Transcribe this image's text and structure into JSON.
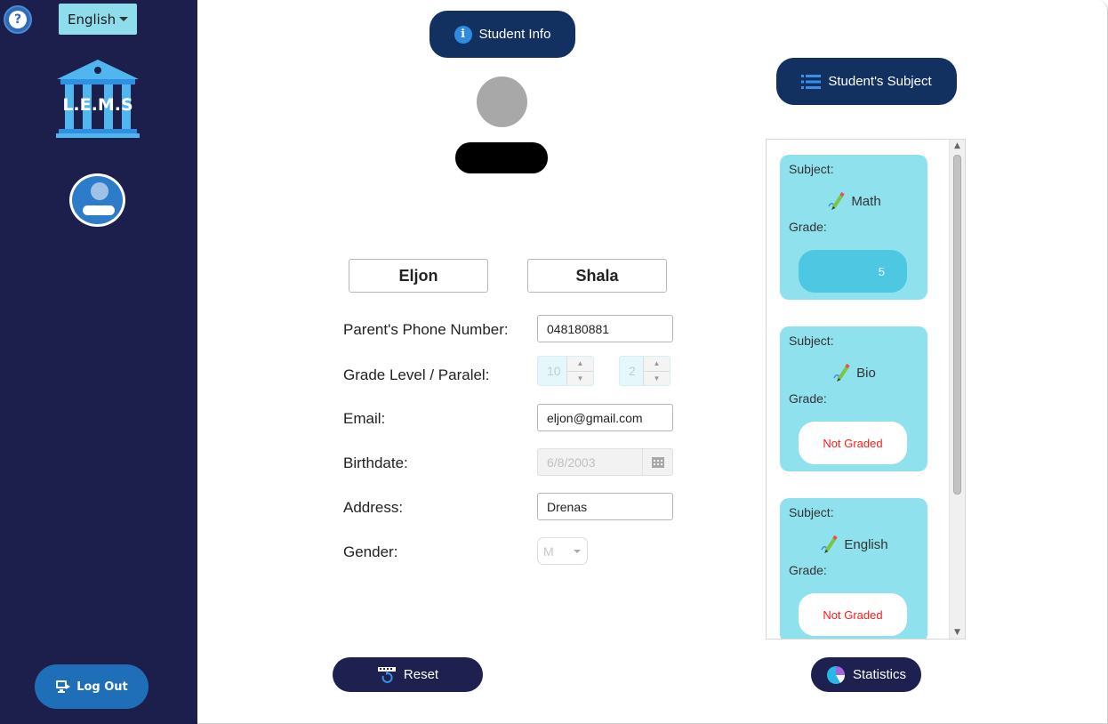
{
  "sidebar": {
    "help_icon_text": "?",
    "language": "English",
    "logo_text": "L.E.M.S",
    "logout_label": "Log Out"
  },
  "header": {
    "student_info_label": "Student Info",
    "subjects_label": "Student's Subject"
  },
  "student": {
    "first_name": "Eljon",
    "last_name": "Shala"
  },
  "form": {
    "phone_label": "Parent's Phone Number:",
    "phone_value": "048180881",
    "grade_label": "Grade Level / Paralel:",
    "grade_level": "10",
    "paralel": "2",
    "email_label": "Email:",
    "email_value": "eljon@gmail.com",
    "birthdate_label": "Birthdate:",
    "birthdate_value": "6/8/2003",
    "address_label": "Address:",
    "address_value": "Drenas",
    "gender_label": "Gender:",
    "gender_value": "M"
  },
  "subjects": [
    {
      "subject_label": "Subject:",
      "name": "Math",
      "grade_label": "Grade:",
      "grade": "5",
      "graded": true
    },
    {
      "subject_label": "Subject:",
      "name": "Bio",
      "grade_label": "Grade:",
      "grade": "Not Graded",
      "graded": false
    },
    {
      "subject_label": "Subject:",
      "name": "English",
      "grade_label": "Grade:",
      "grade": "Not Graded",
      "graded": false
    }
  ],
  "actions": {
    "reset_label": "Reset",
    "statistics_label": "Statistics"
  },
  "colors": {
    "sidebar_bg": "#1c1f4b",
    "primary_button": "#133160",
    "card_bg": "#8fe1ee",
    "not_graded": "#ff1a1a"
  }
}
